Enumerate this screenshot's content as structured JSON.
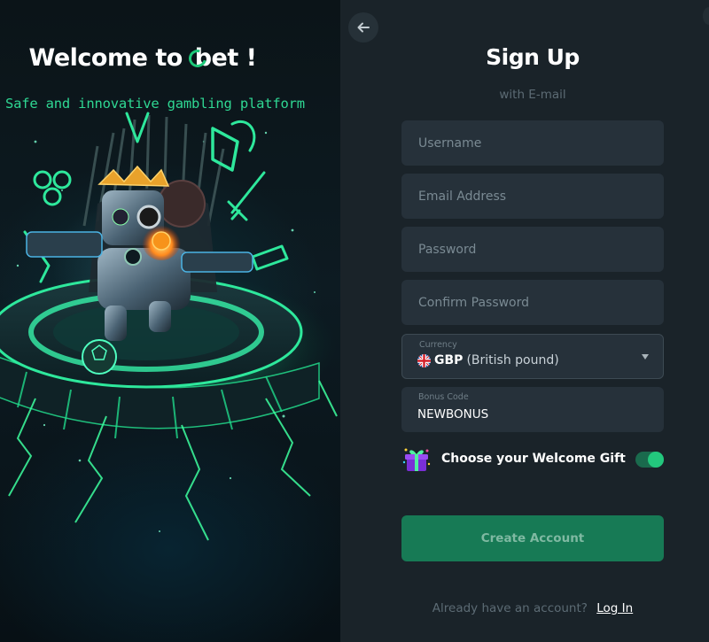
{
  "promo": {
    "title_prefix": "Welcome to",
    "logo_text": "bet",
    "title_suffix": "!",
    "subtitle": "Safe and innovative gambling platform"
  },
  "form": {
    "title": "Sign Up",
    "subtitle": "with E-mail",
    "username_placeholder": "Username",
    "email_placeholder": "Email Address",
    "password_placeholder": "Password",
    "confirm_password_placeholder": "Confirm Password",
    "currency": {
      "label": "Currency",
      "code": "GBP",
      "name": "(British pound)"
    },
    "bonus": {
      "label": "Bonus Code",
      "value": "NEWBONUS"
    },
    "welcome_gift": {
      "label": "Choose your Welcome Gift",
      "enabled": true
    },
    "submit_label": "Create Account",
    "login_prompt": "Already have an account?",
    "login_link": "Log In"
  },
  "colors": {
    "accent": "#23c77d",
    "button": "#177a55",
    "field_bg": "#26313a",
    "page_bg": "#1a2329",
    "promo_subtitle": "#2fd793"
  },
  "icons": {
    "back": "arrow-left-icon",
    "flag": "uk-flag-icon",
    "dropdown": "chevron-down-icon",
    "gift": "gift-icon"
  }
}
